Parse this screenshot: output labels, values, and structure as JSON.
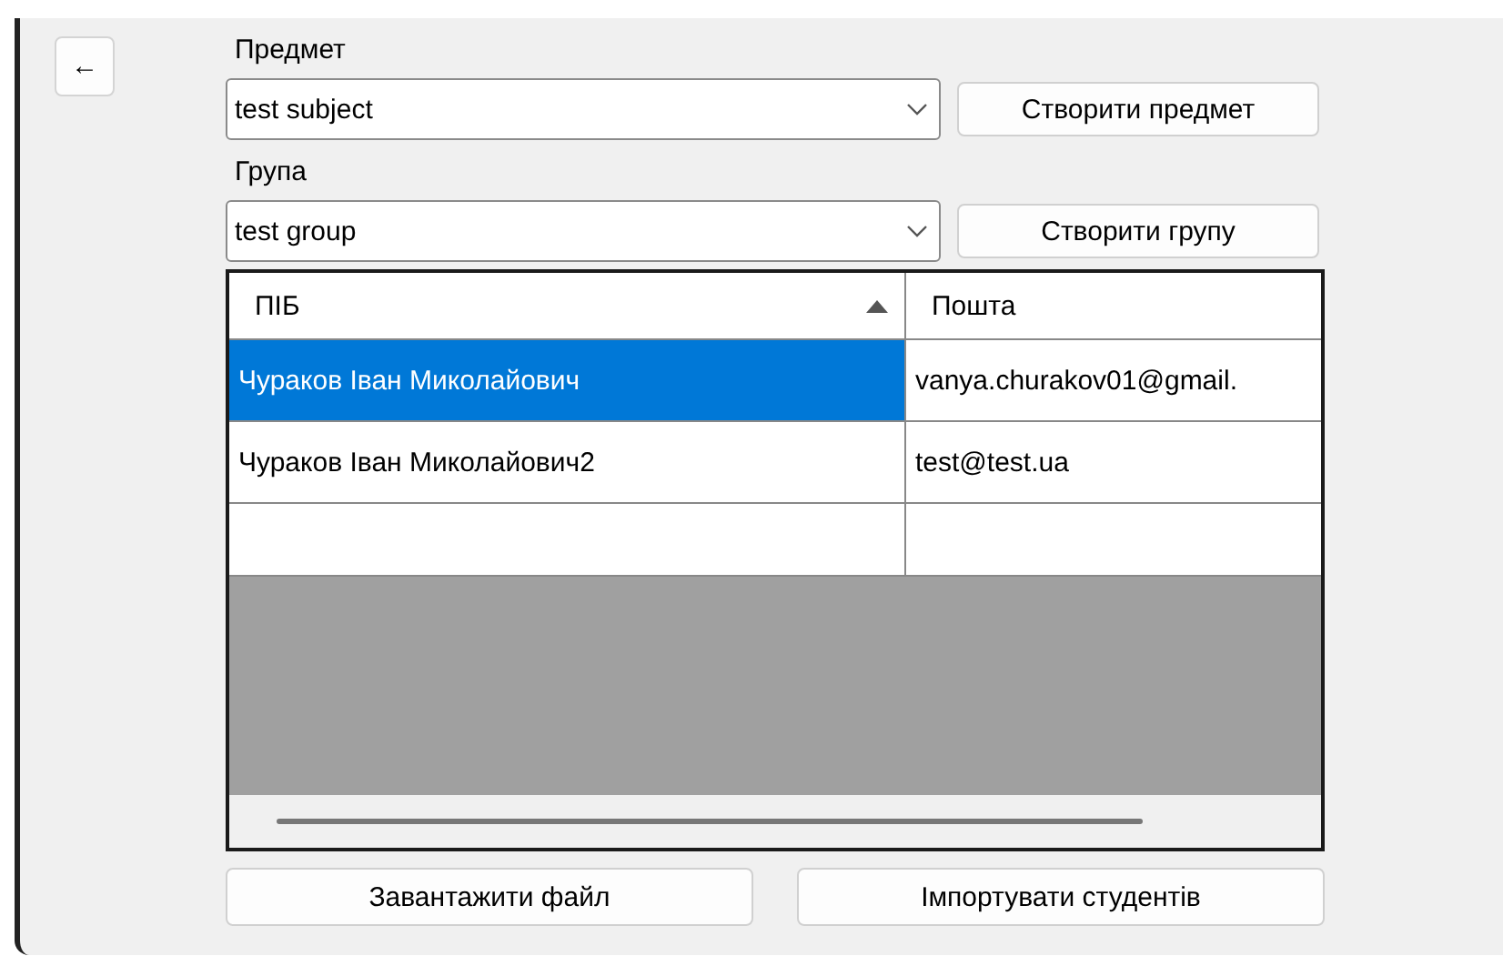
{
  "back_button": {
    "label": "←"
  },
  "subject": {
    "label": "Предмет",
    "value": "test subject",
    "button": "Створити предмет"
  },
  "group": {
    "label": "Група",
    "value": "test group",
    "button": "Створити групу"
  },
  "table": {
    "columns": [
      {
        "label": "ПІБ",
        "sorted": true
      },
      {
        "label": "Пошта",
        "sorted": false
      }
    ],
    "rows": [
      {
        "cells": [
          "Чураков Іван Миколайович",
          "vanya.churakov01@gmail."
        ],
        "selected": true
      },
      {
        "cells": [
          "Чураков Іван Миколайович2",
          "test@test.ua"
        ],
        "selected": false
      }
    ]
  },
  "buttons": [
    "Завантажити файл",
    "Імпортувати студентів"
  ]
}
